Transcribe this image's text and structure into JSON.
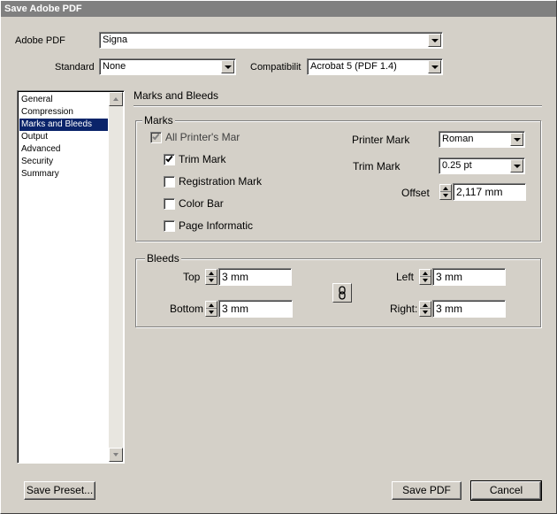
{
  "window": {
    "title": "Save Adobe PDF"
  },
  "header": {
    "adobe_pdf_label": "Adobe PDF",
    "adobe_pdf_value": "Signa",
    "standard_label": "Standard",
    "standard_value": "None",
    "compat_label": "Compatibilit",
    "compat_value": "Acrobat 5 (PDF 1.4)"
  },
  "sidebar": {
    "items": [
      {
        "label": "General",
        "selected": false
      },
      {
        "label": "Compression",
        "selected": false
      },
      {
        "label": "Marks and Bleeds",
        "selected": true
      },
      {
        "label": "Output",
        "selected": false
      },
      {
        "label": "Advanced",
        "selected": false
      },
      {
        "label": "Security",
        "selected": false
      },
      {
        "label": "Summary",
        "selected": false
      }
    ]
  },
  "panel": {
    "title": "Marks and Bleeds",
    "marks": {
      "group_label": "Marks",
      "all_printers_marks": {
        "label": "All Printer's Mar",
        "checked": true,
        "disabled": true
      },
      "trim_marks": {
        "label": "Trim Mark",
        "checked": true
      },
      "registration_marks": {
        "label": "Registration Mark",
        "checked": false
      },
      "color_bar": {
        "label": "Color Bar",
        "checked": false
      },
      "page_information": {
        "label": "Page Informatic",
        "checked": false
      },
      "printer_mark_label": "Printer Mark",
      "printer_mark_value": "Roman",
      "trim_mark_label": "Trim Mark",
      "trim_mark_value": "0.25 pt",
      "offset_label": "Offset",
      "offset_value": "2,117 mm"
    },
    "bleeds": {
      "group_label": "Bleeds",
      "top_label": "Top",
      "top_value": "3 mm",
      "bottom_label": "Bottom",
      "bottom_value": "3 mm",
      "left_label": "Left",
      "left_value": "3 mm",
      "right_label": "Right:",
      "right_value": "3 mm"
    }
  },
  "footer": {
    "save_preset_label": "Save Preset...",
    "save_pdf_label": "Save PDF",
    "cancel_label": "Cancel"
  }
}
